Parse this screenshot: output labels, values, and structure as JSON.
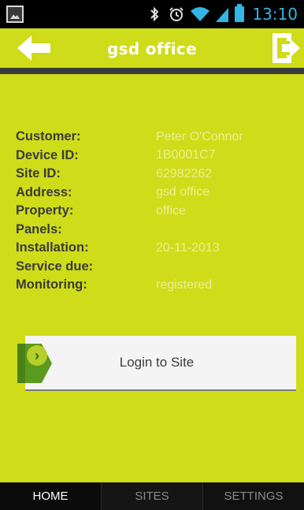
{
  "status_bar": {
    "time": "13:10",
    "icons": [
      "picture-icon",
      "bluetooth-icon",
      "alarm-icon",
      "wifi-icon",
      "signal-icon",
      "battery-icon"
    ],
    "time_color": "#33b5e5"
  },
  "header": {
    "title": "gsd office",
    "back_icon": "arrow-left-icon",
    "logout_icon": "logout-icon"
  },
  "details": [
    {
      "label": "Customer:",
      "value": "Peter O'Connor"
    },
    {
      "label": "Device ID:",
      "value": "1B0001C7"
    },
    {
      "label": "Site ID:",
      "value": "62982262"
    },
    {
      "label": "Address:",
      "value": "gsd office"
    },
    {
      "label": "Property:",
      "value": "office"
    },
    {
      "label": "Panels:",
      "value": ""
    },
    {
      "label": "Installation:",
      "value": "20-11-2013"
    },
    {
      "label": "Service due:",
      "value": ""
    },
    {
      "label": "Monitoring:",
      "value": "registered"
    }
  ],
  "login_button": {
    "label": "Login to Site",
    "icon": "chevron-right-icon"
  },
  "bottom_nav": {
    "tabs": [
      {
        "label": "HOME",
        "active": true
      },
      {
        "label": "SITES",
        "active": false
      },
      {
        "label": "SETTINGS",
        "active": false
      }
    ]
  },
  "colors": {
    "background": "#cfdc1a",
    "label": "#3b3b3b",
    "value": "#eaf092",
    "accent_green": "#5a9a1e"
  }
}
